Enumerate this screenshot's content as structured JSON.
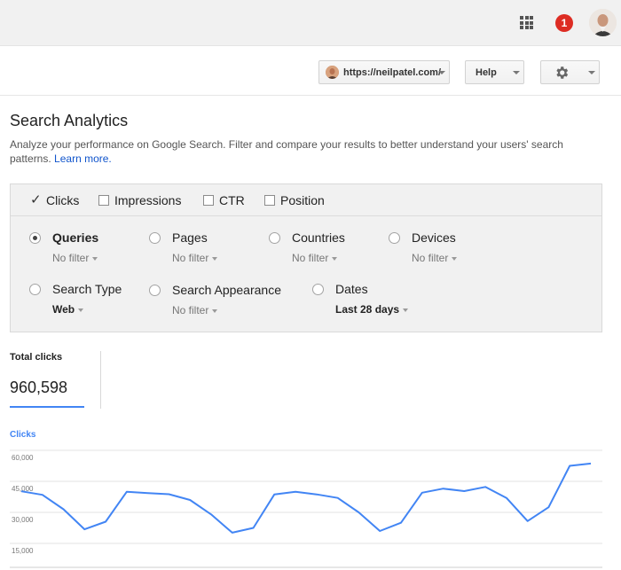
{
  "topbar": {
    "apps_icon": "apps-grid-icon",
    "notification_count": "1",
    "notification_color": "#dd2c23",
    "avatar_icon": "user-avatar"
  },
  "toolbar": {
    "site_label": "https://neilpatel.com/",
    "help_label": "Help",
    "settings_icon": "gear-icon"
  },
  "page": {
    "title": "Search Analytics",
    "description": "Analyze your performance on Google Search. Filter and compare your results to better understand your users' search patterns.",
    "learn_more": "Learn more."
  },
  "metrics": [
    {
      "label": "Clicks",
      "checked": true
    },
    {
      "label": "Impressions",
      "checked": false
    },
    {
      "label": "CTR",
      "checked": false
    },
    {
      "label": "Position",
      "checked": false
    }
  ],
  "dimensions": [
    {
      "label": "Queries",
      "filter": "No filter",
      "selected": true
    },
    {
      "label": "Pages",
      "filter": "No filter",
      "selected": false
    },
    {
      "label": "Countries",
      "filter": "No filter",
      "selected": false
    },
    {
      "label": "Devices",
      "filter": "No filter",
      "selected": false
    },
    {
      "label": "Search Type",
      "filter": "Web",
      "selected": false
    },
    {
      "label": "Search Appearance",
      "filter": "No filter",
      "selected": false
    },
    {
      "label": "Dates",
      "filter": "Last 28 days",
      "selected": false
    }
  ],
  "totals": {
    "label": "Total clicks",
    "value": "960,598"
  },
  "colors": {
    "accent": "#4285f4",
    "link": "#1155cc",
    "panel": "#f1f1f1"
  },
  "chart_data": {
    "type": "line",
    "title": "Clicks",
    "y_ticks": [
      "60,000",
      "45,000",
      "30,000",
      "15,000"
    ],
    "ylim": [
      15000,
      60000
    ],
    "grid": true,
    "series": [
      {
        "name": "Clicks",
        "color": "#4285f4",
        "values": [
          40200,
          38500,
          31500,
          21800,
          25500,
          40000,
          39300,
          38800,
          36000,
          29000,
          20200,
          22500,
          38700,
          40000,
          38700,
          37000,
          30000,
          21000,
          25000,
          39500,
          41500,
          40300,
          42300,
          37000,
          25800,
          32500,
          52500,
          53600
        ]
      }
    ]
  }
}
